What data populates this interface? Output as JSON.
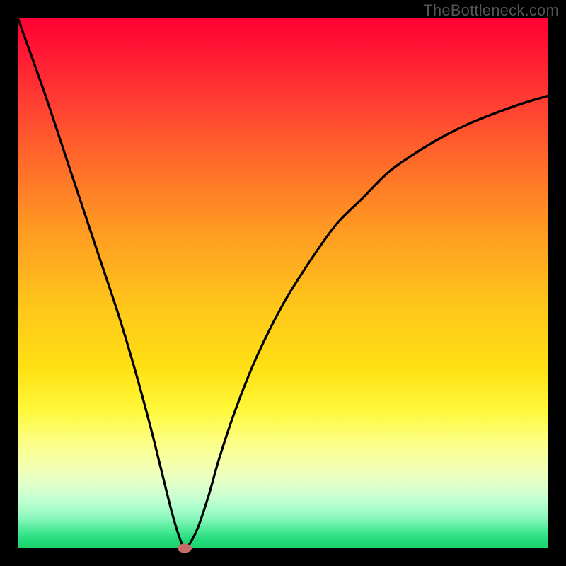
{
  "watermark": "TheBottleneck.com",
  "chart_data": {
    "type": "line",
    "title": "",
    "xlabel": "",
    "ylabel": "",
    "xlim": [
      0,
      100
    ],
    "ylim": [
      0,
      100
    ],
    "grid": false,
    "series": [
      {
        "name": "bottleneck-curve",
        "x": [
          0,
          5,
          10,
          15,
          19,
          22,
          25,
          27,
          29,
          30.5,
          31.5,
          32.5,
          34,
          36,
          38,
          41,
          45,
          50,
          55,
          60,
          65,
          70,
          75,
          80,
          85,
          90,
          95,
          100
        ],
        "y": [
          100,
          86,
          71,
          56,
          44,
          34,
          23,
          15,
          7,
          2,
          0,
          1,
          4,
          10,
          17,
          26,
          36,
          46,
          54,
          61,
          66,
          71,
          74.5,
          77.5,
          80,
          82,
          83.8,
          85.3
        ]
      }
    ],
    "annotations": [
      {
        "type": "marker",
        "x": 31.5,
        "y": 0,
        "color": "#c86a6a"
      }
    ],
    "background": {
      "type": "vertical-gradient",
      "stops": [
        {
          "pos": 0,
          "color": "#ff0033"
        },
        {
          "pos": 50,
          "color": "#ffc000"
        },
        {
          "pos": 78,
          "color": "#ffff55"
        },
        {
          "pos": 100,
          "color": "#20d070"
        }
      ]
    }
  }
}
